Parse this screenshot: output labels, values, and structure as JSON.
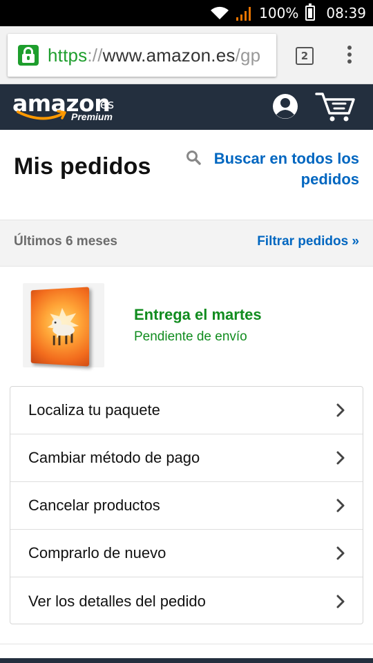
{
  "status_bar": {
    "battery": "100%",
    "time": "08:39"
  },
  "browser": {
    "url_scheme": "https",
    "url_sep": "://",
    "url_domain": "www.amazon.es",
    "url_path": "/gp",
    "tab_count": "2",
    "lock_color": "#1e9e2d"
  },
  "header": {
    "logo_word": "amazon",
    "logo_tld": ".es",
    "logo_sub": "Premium",
    "bg_color": "#232f3e",
    "icons": [
      "account-icon",
      "cart-icon"
    ]
  },
  "page": {
    "title": "Mis pedidos",
    "search_all_label": "Buscar en todos los pedidos",
    "link_color": "#0066c0"
  },
  "filter": {
    "period": "Últimos 6 meses",
    "link": "Filtrar pedidos »"
  },
  "order": {
    "delivery_title": "Entrega el martes",
    "delivery_status": "Pendiente de envío",
    "status_color": "#118c1f"
  },
  "actions": [
    {
      "label": "Localiza tu paquete"
    },
    {
      "label": "Cambiar método de pago"
    },
    {
      "label": "Cancelar productos"
    },
    {
      "label": "Comprarlo de nuevo"
    },
    {
      "label": "Ver los detalles del pedido"
    }
  ]
}
